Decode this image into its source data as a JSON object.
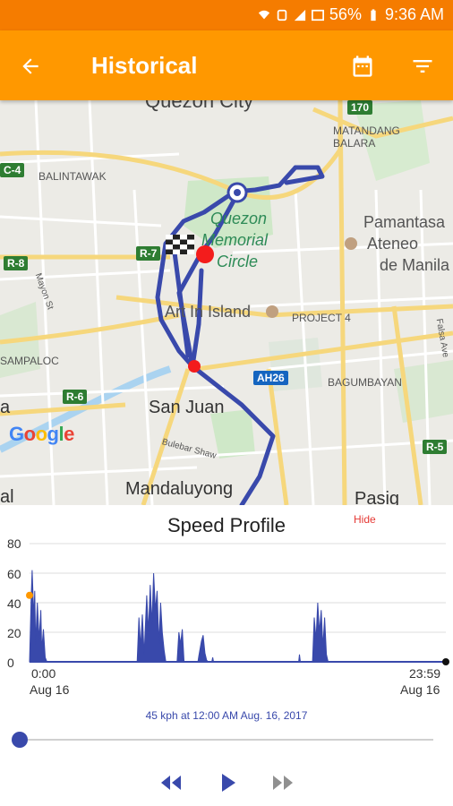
{
  "status_bar": {
    "battery": "56%",
    "time": "9:36 AM"
  },
  "app_bar": {
    "title": "Historical",
    "icons": [
      "back-arrow-icon",
      "calendar-icon",
      "filter-icon"
    ]
  },
  "map": {
    "labels": {
      "quezon_city": "Quezon City",
      "matandang": "MATANDANG",
      "balara": "BALARA",
      "balintawak": "BALINTAWAK",
      "qmc1": "Quezon",
      "qmc2": "Memorial",
      "qmc3": "Circle",
      "pamantasan": "Pamantasa",
      "ateneo": "Ateneo",
      "de_manila": "de Manila",
      "art_in_island": "Art In Island",
      "project4": "PROJECT 4",
      "sampaloc": "SAMPALOC",
      "bagumbayan": "BAGUMBAYAN",
      "san_juan": "San Juan",
      "mandaluyong": "Mandaluyong",
      "pasig": "Pasig",
      "a_left": "a",
      "l_left": "al",
      "mayon": "Mayon St",
      "bulebar": "Bulebar Shaw",
      "falsa": "Falsa Ave"
    },
    "road_badges": {
      "c4": "C-4",
      "r7": "R-7",
      "r8": "R-8",
      "r6": "R-6",
      "r5": "R-5",
      "ah26": "AH26",
      "n170": "170"
    },
    "attribution": "Google"
  },
  "speed_profile": {
    "title": "Speed Profile",
    "hide_label": "Hide",
    "y_ticks": [
      "80",
      "60",
      "40",
      "20",
      "0"
    ],
    "x_start_time": "0:00",
    "x_start_date": "Aug 16",
    "x_end_time": "23:59",
    "x_end_date": "Aug 16",
    "status_text": "45 kph at 12:00 AM Aug. 16, 2017"
  },
  "chart_data": {
    "type": "area",
    "title": "Speed Profile",
    "ylim": [
      0,
      80
    ],
    "y_ticks": [
      0,
      20,
      40,
      60,
      80
    ],
    "x_range": [
      "0:00",
      "23:59"
    ],
    "points": [
      [
        0.0,
        0
      ],
      [
        0.1,
        45
      ],
      [
        0.15,
        62
      ],
      [
        0.25,
        30
      ],
      [
        0.3,
        48
      ],
      [
        0.35,
        12
      ],
      [
        0.45,
        40
      ],
      [
        0.55,
        15
      ],
      [
        0.65,
        35
      ],
      [
        0.7,
        8
      ],
      [
        0.8,
        22
      ],
      [
        0.9,
        3
      ],
      [
        1.0,
        0
      ],
      [
        6.2,
        0
      ],
      [
        6.3,
        30
      ],
      [
        6.4,
        10
      ],
      [
        6.5,
        32
      ],
      [
        6.6,
        5
      ],
      [
        6.75,
        45
      ],
      [
        6.85,
        20
      ],
      [
        6.95,
        52
      ],
      [
        7.05,
        25
      ],
      [
        7.15,
        60
      ],
      [
        7.25,
        35
      ],
      [
        7.35,
        48
      ],
      [
        7.45,
        12
      ],
      [
        7.55,
        40
      ],
      [
        7.65,
        20
      ],
      [
        7.75,
        8
      ],
      [
        7.85,
        0
      ],
      [
        8.5,
        0
      ],
      [
        8.6,
        20
      ],
      [
        8.7,
        12
      ],
      [
        8.8,
        22
      ],
      [
        8.9,
        0
      ],
      [
        9.7,
        0
      ],
      [
        9.75,
        4
      ],
      [
        9.9,
        14
      ],
      [
        10.0,
        18
      ],
      [
        10.1,
        6
      ],
      [
        10.2,
        1
      ],
      [
        10.3,
        0
      ],
      [
        10.5,
        0
      ],
      [
        10.55,
        3
      ],
      [
        10.6,
        0
      ],
      [
        15.5,
        0
      ],
      [
        15.55,
        5
      ],
      [
        15.6,
        0
      ],
      [
        16.3,
        0
      ],
      [
        16.4,
        30
      ],
      [
        16.5,
        15
      ],
      [
        16.6,
        40
      ],
      [
        16.7,
        20
      ],
      [
        16.8,
        35
      ],
      [
        16.9,
        10
      ],
      [
        17.0,
        30
      ],
      [
        17.1,
        5
      ],
      [
        17.2,
        0
      ],
      [
        23.98,
        0
      ]
    ]
  },
  "playback": {
    "progress": 0.0
  }
}
